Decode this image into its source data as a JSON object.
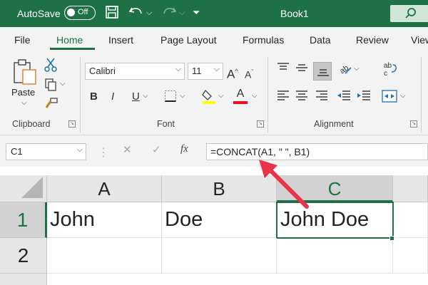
{
  "titlebar": {
    "autosave_label": "AutoSave",
    "autosave_state": "Off",
    "workbook_title": "Book1"
  },
  "tabs": [
    "File",
    "Home",
    "Insert",
    "Page Layout",
    "Formulas",
    "Data",
    "Review",
    "View"
  ],
  "active_tab": "Home",
  "ribbon": {
    "clipboard": {
      "paste_label": "Paste",
      "group_label": "Clipboard"
    },
    "font": {
      "font_name": "Calibri",
      "font_size": "11",
      "bold": "B",
      "italic": "I",
      "underline": "U",
      "grow": "A",
      "shrink": "A",
      "font_color_letter": "A",
      "group_label": "Font",
      "highlight_color": "#ffff00",
      "font_color": "#e81123"
    },
    "alignment": {
      "group_label": "Alignment"
    }
  },
  "formula_bar": {
    "name_box": "C1",
    "fx": "fx",
    "formula": "=CONCAT(A1, \" \", B1)"
  },
  "grid": {
    "columns": [
      "A",
      "B",
      "C"
    ],
    "rows": [
      "1",
      "2"
    ],
    "cells": {
      "A1": "John",
      "B1": "Doe",
      "C1": "John Doe"
    },
    "active_cell": "C1"
  },
  "annotation": {
    "arrow_color": "#e8334a"
  },
  "colors": {
    "accent": "#1e7145"
  }
}
